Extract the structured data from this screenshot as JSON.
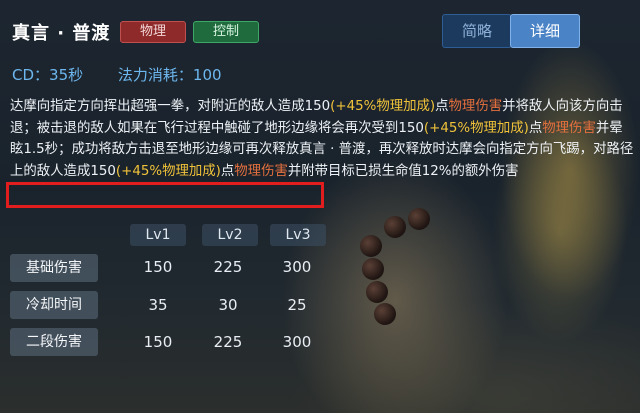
{
  "skill": {
    "title": "真言 · 普渡",
    "tags": [
      "物理",
      "控制"
    ]
  },
  "view_toggle": {
    "brief": "简略",
    "detail": "详细"
  },
  "stats": {
    "cd": "CD：35秒",
    "mana": "法力消耗：100"
  },
  "description": [
    {
      "t": "达摩向指定方向挥出超强一拳，对附近的敌人造成150",
      "c": "w"
    },
    {
      "t": "(+45%物理加成)",
      "c": "y"
    },
    {
      "t": "点",
      "c": "w"
    },
    {
      "t": "物理伤害",
      "c": "r"
    },
    {
      "t": "并将敌人向该方向击退；被击退的敌人如果在飞行过程中触碰了地形边缘将会再次受到150",
      "c": "w"
    },
    {
      "t": "(+45%物理加成)",
      "c": "y"
    },
    {
      "t": "点",
      "c": "w"
    },
    {
      "t": "物理伤害",
      "c": "r"
    },
    {
      "t": "并晕眩1.5秒；成功将敌方击退至地形边缘可再次释放真言 · 普渡，再次释放时达摩会向指定方向飞踢，对路径上的敌人造成150",
      "c": "w"
    },
    {
      "t": "(+45%物理加成)",
      "c": "y"
    },
    {
      "t": "点",
      "c": "w"
    },
    {
      "t": "物理伤害",
      "c": "r"
    },
    {
      "t": "并附带目标已损生命值12%的额外伤害",
      "c": "w"
    }
  ],
  "table": {
    "levels": [
      "Lv1",
      "Lv2",
      "Lv3"
    ],
    "rows": [
      {
        "label": "基础伤害",
        "values": [
          "150",
          "225",
          "300"
        ]
      },
      {
        "label": "冷却时间",
        "values": [
          "35",
          "30",
          "25"
        ]
      },
      {
        "label": "二段伤害",
        "values": [
          "150",
          "225",
          "300"
        ]
      }
    ]
  },
  "colors": {
    "stat_blue": "#6db7ee",
    "bonus_yellow": "#f0c23a",
    "damage_orange": "#e4703e",
    "highlight_box_red": "#e21d1d",
    "tag_physical": "#8e2a2a",
    "tag_control": "#1f6b3d",
    "toggle_active": "#4a83c6"
  }
}
